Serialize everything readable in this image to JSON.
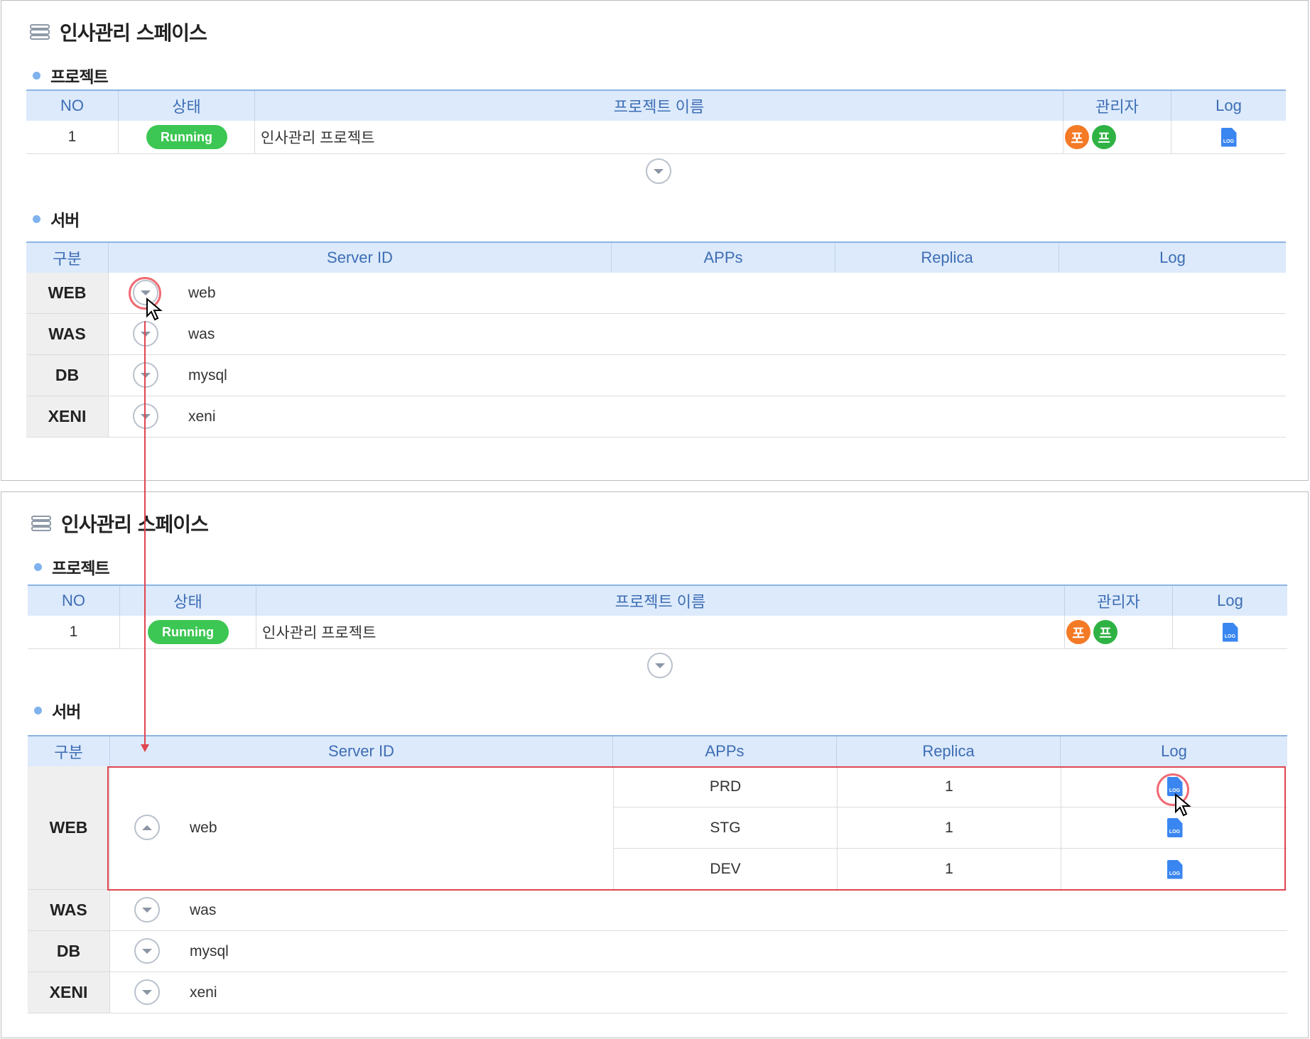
{
  "space_title": "인사관리 스페이스",
  "project_section": "프로젝트",
  "server_section": "서버",
  "project_table": {
    "headers": {
      "no": "NO",
      "status": "상태",
      "name": "프로젝트 이름",
      "manager": "관리자",
      "log": "Log"
    },
    "row": {
      "no": "1",
      "status": "Running",
      "name": "인사관리 프로젝트",
      "managers": [
        "포",
        "프"
      ],
      "log_icon": "LOG"
    }
  },
  "server_table": {
    "headers": {
      "gubun": "구분",
      "server_id": "Server ID",
      "apps": "APPs",
      "replica": "Replica",
      "log": "Log"
    },
    "rows": [
      {
        "gubun": "WEB",
        "server_id": "web"
      },
      {
        "gubun": "WAS",
        "server_id": "was"
      },
      {
        "gubun": "DB",
        "server_id": "mysql"
      },
      {
        "gubun": "XENI",
        "server_id": "xeni"
      }
    ],
    "web_apps": [
      {
        "app": "PRD",
        "replica": "1",
        "log_icon": "LOG"
      },
      {
        "app": "STG",
        "replica": "1",
        "log_icon": "LOG"
      },
      {
        "app": "DEV",
        "replica": "1",
        "log_icon": "LOG"
      }
    ]
  },
  "colors": {
    "accent": "#3e6db5",
    "running": "#3cc653",
    "highlight": "#e0454f",
    "manager1": "#f47a26",
    "manager2": "#2fb244",
    "log_icon": "#3a86f0"
  }
}
